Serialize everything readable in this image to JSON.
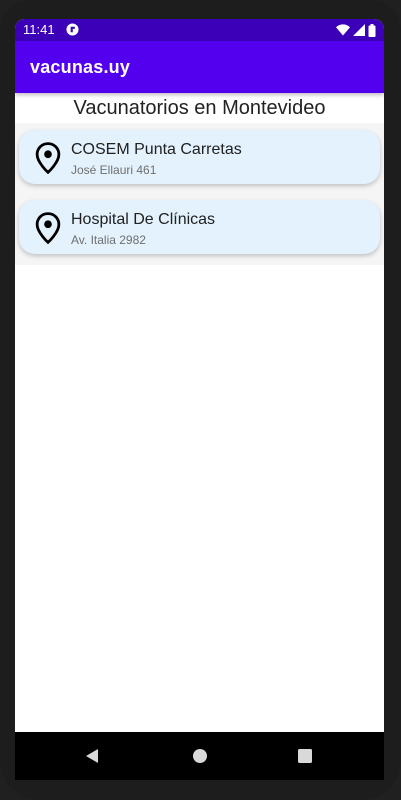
{
  "status_bar": {
    "time": "11:41"
  },
  "app_bar": {
    "title": "vacunas.uy"
  },
  "page": {
    "title": "Vacunatorios en Montevideo"
  },
  "vaccination_centers": [
    {
      "name": "COSEM Punta Carretas",
      "address": "José Ellauri 461",
      "icon": "location-pin-icon"
    },
    {
      "name": "Hospital De Clínicas",
      "address": "Av. Italia 2982",
      "icon": "location-pin-icon"
    }
  ],
  "colors": {
    "status_bar": "#3b00b8",
    "app_bar": "#5200ee",
    "card_background": "#e3f2fd"
  }
}
